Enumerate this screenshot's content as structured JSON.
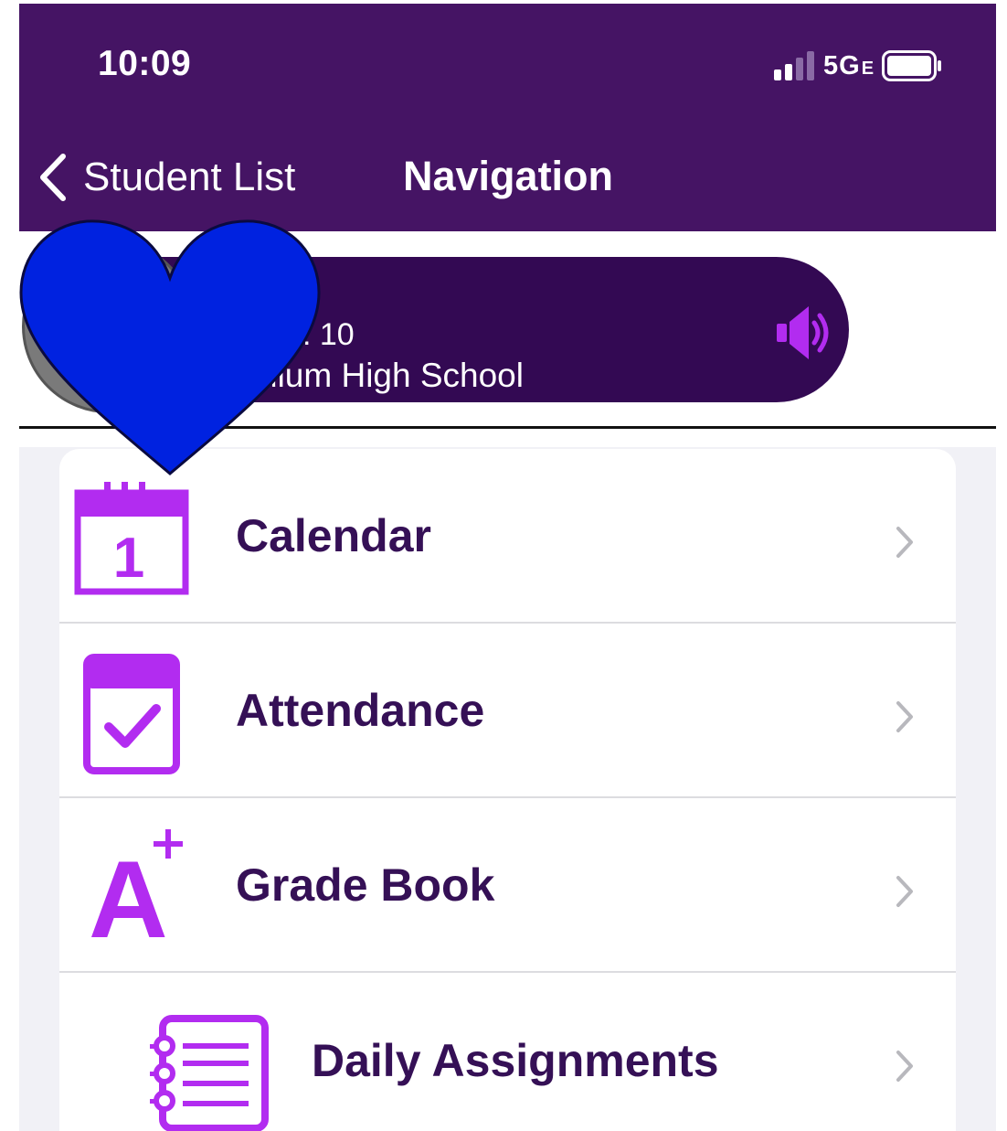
{
  "status_bar": {
    "time": "10:09",
    "network": "5G",
    "network_suffix": "E"
  },
  "header": {
    "back_label": "Student List",
    "title": "Navigation"
  },
  "profile": {
    "grade_text": ": 10",
    "school_text": "dium High School"
  },
  "menu": {
    "items": [
      {
        "label": "Calendar",
        "icon": "calendar-icon",
        "icon_text": "1"
      },
      {
        "label": "Attendance",
        "icon": "attendance-check-icon"
      },
      {
        "label": "Grade Book",
        "icon": "grade-a-plus-icon",
        "icon_text": "A"
      },
      {
        "label": "Daily Assignments",
        "icon": "notebook-list-icon"
      }
    ]
  },
  "colors": {
    "header_bg": "#451464",
    "pill_bg": "#330953",
    "accent": "#B22CF0",
    "label": "#351056",
    "sticker": "#0022E0"
  }
}
